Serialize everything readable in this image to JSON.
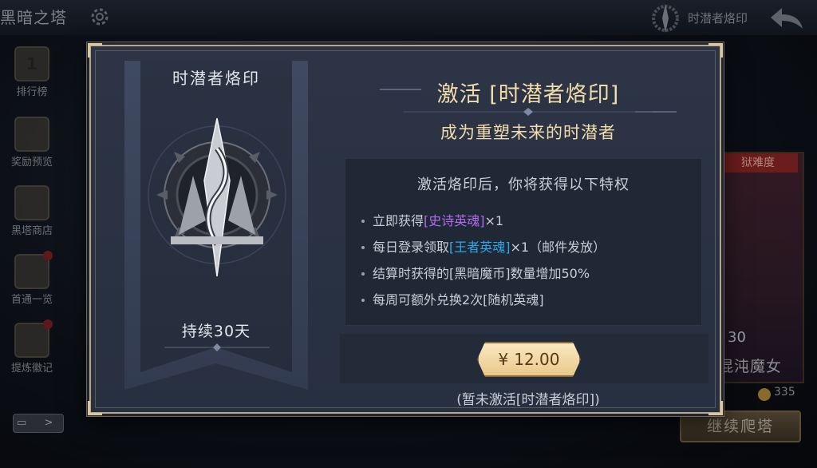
{
  "background": {
    "title": "黑暗之塔",
    "brand": "时潜者烙印",
    "sidebar": [
      {
        "label": "排行榜",
        "badge": "1"
      },
      {
        "label": "奖励预览"
      },
      {
        "label": "黑塔商店"
      },
      {
        "label": "首通一览"
      },
      {
        "label": "提炼徽记"
      }
    ],
    "difficulty_tag": "狱难度",
    "hero_level": "30",
    "hero_name": "混沌魔女",
    "coin_count": "335",
    "continue_button": "继续爬塔",
    "chat_arrow": ">"
  },
  "modal": {
    "banner_title": "时潜者烙印",
    "banner_duration": "持续30天",
    "title": "激活 [时潜者烙印]",
    "subtitle": "成为重塑未来的时潜者",
    "privileges_heading": "激活烙印后，你将获得以下特权",
    "privileges": [
      {
        "prefix": "立即获得",
        "highlight": "[史诗英魂]",
        "suffix": "×1",
        "color": "#b06cf0"
      },
      {
        "prefix": "每日登录领取",
        "highlight": "[王者英魂]",
        "suffix": "×1（邮件发放）",
        "color": "#2fa6ea"
      },
      {
        "prefix": "结算时获得的[黑暗魔币]数量增加50%",
        "highlight": "",
        "suffix": ""
      },
      {
        "prefix": "每周可额外兑换2次[随机英魂]",
        "highlight": "",
        "suffix": ""
      }
    ],
    "price_currency": "¥",
    "price_value": "12.00",
    "status": "(暂未激活[时潜者烙印])"
  },
  "colors": {
    "gold_text": "#f2dcaa",
    "frame": "#b7a889",
    "purple_highlight": "#b06cf0",
    "cyan_highlight": "#2fa6ea"
  }
}
